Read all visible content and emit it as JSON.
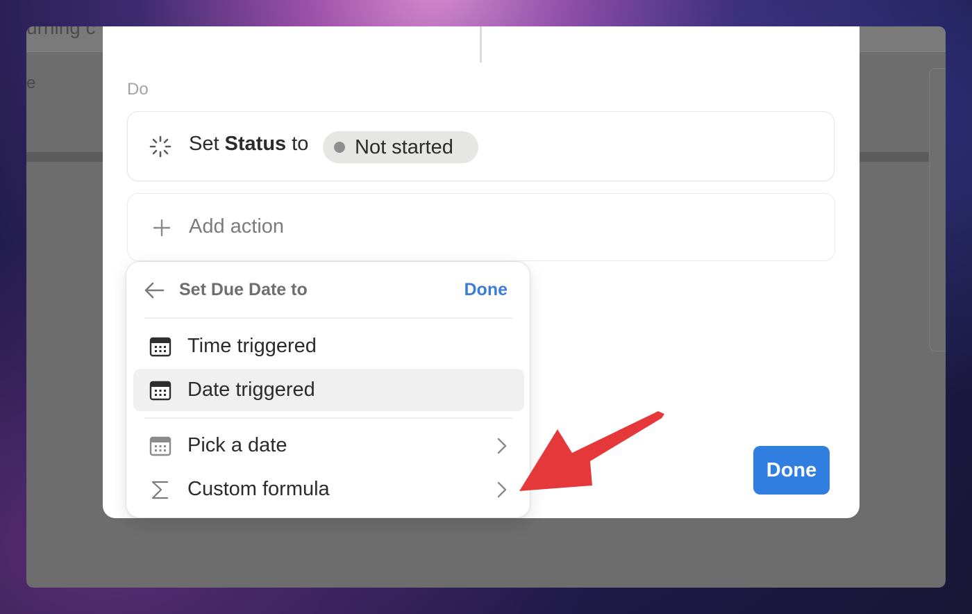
{
  "background_app": {
    "title_fragment": "urning c",
    "letter_fragment": "e"
  },
  "modal": {
    "section_label": "Do",
    "action": {
      "prefix": "Set",
      "property": "Status",
      "suffix": "to",
      "value": "Not started",
      "icon": "status-loading-icon"
    },
    "add_action_label": "Add action",
    "done_label": "Done"
  },
  "popover": {
    "title": "Set Due Date to",
    "done_label": "Done",
    "options": [
      {
        "label": "Time triggered",
        "icon": "calendar-icon"
      },
      {
        "label": "Date triggered",
        "icon": "calendar-icon",
        "highlighted": true
      },
      {
        "label": "Pick a date",
        "icon": "calendar-icon",
        "has_submenu": true
      },
      {
        "label": "Custom formula",
        "icon": "sigma-icon",
        "has_submenu": true
      }
    ]
  },
  "colors": {
    "accent": "#2f7ee0",
    "annotation_arrow": "#e5383b",
    "status_pill_bg": "#e6e6e4",
    "status_dot": "#8e8e8e"
  }
}
